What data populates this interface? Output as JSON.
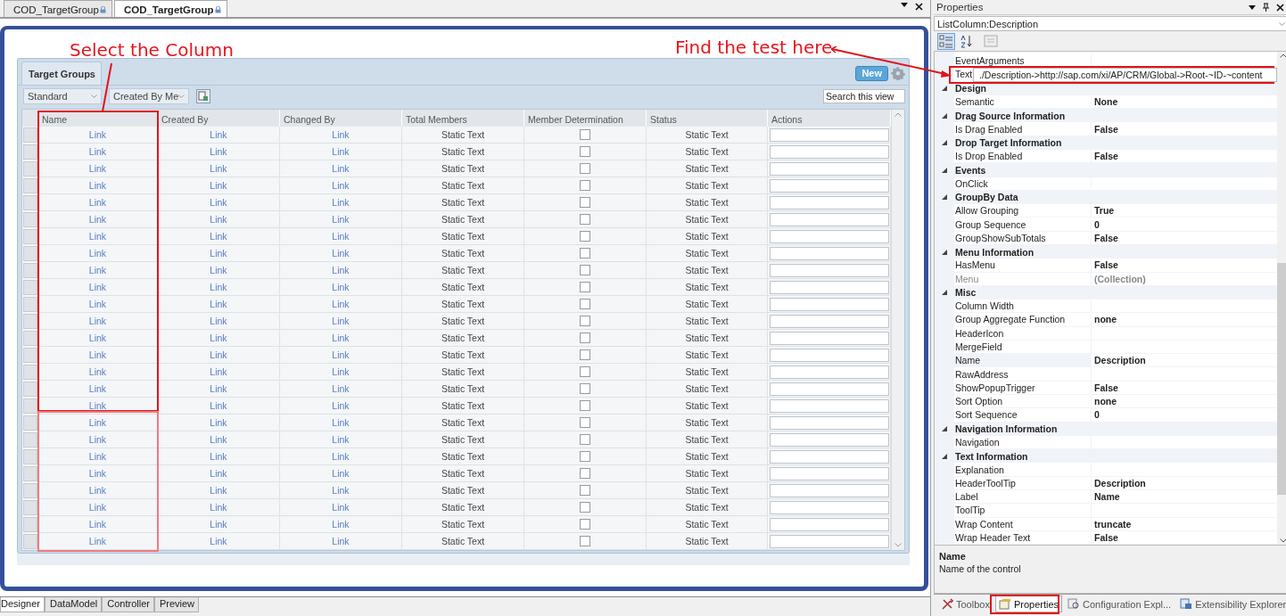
{
  "document_tabs": [
    {
      "label": "COD_TargetGroup",
      "selected": false
    },
    {
      "label": "COD_TargetGroup",
      "selected": true
    }
  ],
  "card": {
    "title": "Target Groups",
    "new_button": "New",
    "filters": [
      {
        "value": "Standard"
      },
      {
        "value": "Created By Me"
      }
    ],
    "search": {
      "placeholder": "Search this view"
    }
  },
  "table": {
    "columns": [
      "Name",
      "Created By",
      "Changed By",
      "Total Members",
      "Member Determination",
      "Status",
      "Actions"
    ],
    "rows": [
      {
        "name": "Link",
        "created_by": "Link",
        "changed_by": "Link",
        "total_members": "Static Text",
        "member_determination": false,
        "status": "Static Text"
      },
      {
        "name": "Link",
        "created_by": "Link",
        "changed_by": "Link",
        "total_members": "Static Text",
        "member_determination": false,
        "status": "Static Text"
      },
      {
        "name": "Link",
        "created_by": "Link",
        "changed_by": "Link",
        "total_members": "Static Text",
        "member_determination": false,
        "status": "Static Text"
      },
      {
        "name": "Link",
        "created_by": "Link",
        "changed_by": "Link",
        "total_members": "Static Text",
        "member_determination": false,
        "status": "Static Text"
      },
      {
        "name": "Link",
        "created_by": "Link",
        "changed_by": "Link",
        "total_members": "Static Text",
        "member_determination": false,
        "status": "Static Text"
      },
      {
        "name": "Link",
        "created_by": "Link",
        "changed_by": "Link",
        "total_members": "Static Text",
        "member_determination": false,
        "status": "Static Text"
      },
      {
        "name": "Link",
        "created_by": "Link",
        "changed_by": "Link",
        "total_members": "Static Text",
        "member_determination": false,
        "status": "Static Text"
      },
      {
        "name": "Link",
        "created_by": "Link",
        "changed_by": "Link",
        "total_members": "Static Text",
        "member_determination": false,
        "status": "Static Text"
      },
      {
        "name": "Link",
        "created_by": "Link",
        "changed_by": "Link",
        "total_members": "Static Text",
        "member_determination": false,
        "status": "Static Text"
      },
      {
        "name": "Link",
        "created_by": "Link",
        "changed_by": "Link",
        "total_members": "Static Text",
        "member_determination": false,
        "status": "Static Text"
      },
      {
        "name": "Link",
        "created_by": "Link",
        "changed_by": "Link",
        "total_members": "Static Text",
        "member_determination": false,
        "status": "Static Text"
      },
      {
        "name": "Link",
        "created_by": "Link",
        "changed_by": "Link",
        "total_members": "Static Text",
        "member_determination": false,
        "status": "Static Text"
      },
      {
        "name": "Link",
        "created_by": "Link",
        "changed_by": "Link",
        "total_members": "Static Text",
        "member_determination": false,
        "status": "Static Text"
      },
      {
        "name": "Link",
        "created_by": "Link",
        "changed_by": "Link",
        "total_members": "Static Text",
        "member_determination": false,
        "status": "Static Text"
      },
      {
        "name": "Link",
        "created_by": "Link",
        "changed_by": "Link",
        "total_members": "Static Text",
        "member_determination": false,
        "status": "Static Text"
      },
      {
        "name": "Link",
        "created_by": "Link",
        "changed_by": "Link",
        "total_members": "Static Text",
        "member_determination": false,
        "status": "Static Text"
      },
      {
        "name": "Link",
        "created_by": "Link",
        "changed_by": "Link",
        "total_members": "Static Text",
        "member_determination": false,
        "status": "Static Text"
      },
      {
        "name": "Link",
        "created_by": "Link",
        "changed_by": "Link",
        "total_members": "Static Text",
        "member_determination": false,
        "status": "Static Text"
      },
      {
        "name": "Link",
        "created_by": "Link",
        "changed_by": "Link",
        "total_members": "Static Text",
        "member_determination": false,
        "status": "Static Text"
      },
      {
        "name": "Link",
        "created_by": "Link",
        "changed_by": "Link",
        "total_members": "Static Text",
        "member_determination": false,
        "status": "Static Text"
      },
      {
        "name": "Link",
        "created_by": "Link",
        "changed_by": "Link",
        "total_members": "Static Text",
        "member_determination": false,
        "status": "Static Text"
      },
      {
        "name": "Link",
        "created_by": "Link",
        "changed_by": "Link",
        "total_members": "Static Text",
        "member_determination": false,
        "status": "Static Text"
      },
      {
        "name": "Link",
        "created_by": "Link",
        "changed_by": "Link",
        "total_members": "Static Text",
        "member_determination": false,
        "status": "Static Text"
      },
      {
        "name": "Link",
        "created_by": "Link",
        "changed_by": "Link",
        "total_members": "Static Text",
        "member_determination": false,
        "status": "Static Text"
      },
      {
        "name": "Link",
        "created_by": "Link",
        "changed_by": "Link",
        "total_members": "Static Text",
        "member_determination": false,
        "status": "Static Text"
      }
    ]
  },
  "designer_tabs": [
    {
      "label": "Designer",
      "selected": true
    },
    {
      "label": "DataModel",
      "selected": false
    },
    {
      "label": "Controller",
      "selected": false
    },
    {
      "label": "Preview",
      "selected": false
    }
  ],
  "properties": {
    "title": "Properties",
    "object": "ListColumn:Description",
    "sort_modes": [
      {
        "kind": "categorized",
        "selected": true
      },
      {
        "kind": "alphabetical",
        "selected": false
      }
    ],
    "rows": [
      {
        "kind": "item",
        "name": "EventArguments",
        "disabled": false,
        "selected": false
      },
      {
        "kind": "editing",
        "name": "Text",
        "value": "./Description->http://sap.com/xi/AP/CRM/Global->Root-~ID-~content",
        "disabled": false,
        "selected": false
      },
      {
        "kind": "group",
        "name": "Design",
        "expanded": true
      },
      {
        "kind": "item",
        "name": "Semantic",
        "value": "None",
        "disabled": false,
        "selected": false
      },
      {
        "kind": "group",
        "name": "Drag Source Information",
        "expanded": true
      },
      {
        "kind": "item",
        "name": "Is Drag Enabled",
        "value": "False",
        "disabled": false,
        "selected": false
      },
      {
        "kind": "group",
        "name": "Drop Target Information",
        "expanded": true
      },
      {
        "kind": "item",
        "name": "Is Drop Enabled",
        "value": "False",
        "disabled": false,
        "selected": false
      },
      {
        "kind": "group",
        "name": "Events",
        "expanded": true
      },
      {
        "kind": "item",
        "name": "OnClick",
        "disabled": false,
        "selected": false
      },
      {
        "kind": "group",
        "name": "GroupBy Data",
        "expanded": true
      },
      {
        "kind": "item",
        "name": "Allow Grouping",
        "value": "True",
        "disabled": false,
        "selected": false
      },
      {
        "kind": "item",
        "name": "Group Sequence",
        "value": "0",
        "disabled": false,
        "selected": false
      },
      {
        "kind": "item",
        "name": "GroupShowSubTotals",
        "value": "False",
        "disabled": false,
        "selected": false
      },
      {
        "kind": "group",
        "name": "Menu Information",
        "expanded": true
      },
      {
        "kind": "item",
        "name": "HasMenu",
        "value": "False",
        "disabled": false,
        "selected": false
      },
      {
        "kind": "item",
        "name": "Menu",
        "value": "(Collection)",
        "disabled": true,
        "selected": false
      },
      {
        "kind": "group",
        "name": "Misc",
        "expanded": true
      },
      {
        "kind": "item",
        "name": "Column Width",
        "disabled": false,
        "selected": false
      },
      {
        "kind": "item",
        "name": "Group Aggregate Function",
        "value": "none",
        "disabled": false,
        "selected": false
      },
      {
        "kind": "item",
        "name": "HeaderIcon",
        "disabled": false,
        "selected": false
      },
      {
        "kind": "item",
        "name": "MergeField",
        "disabled": false,
        "selected": false
      },
      {
        "kind": "item",
        "name": "Name",
        "value": "Description",
        "disabled": false,
        "selected": true
      },
      {
        "kind": "item",
        "name": "RawAddress",
        "disabled": false,
        "selected": false
      },
      {
        "kind": "item",
        "name": "ShowPopupTrigger",
        "value": "False",
        "disabled": false,
        "selected": false
      },
      {
        "kind": "item",
        "name": "Sort Option",
        "value": "none",
        "disabled": false,
        "selected": false
      },
      {
        "kind": "item",
        "name": "Sort Sequence",
        "value": "0",
        "disabled": false,
        "selected": false
      },
      {
        "kind": "group",
        "name": "Navigation Information",
        "expanded": true
      },
      {
        "kind": "item",
        "name": "Navigation",
        "disabled": false,
        "selected": false
      },
      {
        "kind": "group",
        "name": "Text Information",
        "expanded": true
      },
      {
        "kind": "item",
        "name": "Explanation",
        "disabled": false,
        "selected": false
      },
      {
        "kind": "item",
        "name": "HeaderToolTip",
        "value": "Description",
        "disabled": false,
        "selected": false
      },
      {
        "kind": "item",
        "name": "Label",
        "value": "Name",
        "disabled": false,
        "selected": false
      },
      {
        "kind": "item",
        "name": "ToolTip",
        "disabled": false,
        "selected": false
      },
      {
        "kind": "item",
        "name": "Wrap Content",
        "value": "truncate",
        "disabled": false,
        "selected": false
      },
      {
        "kind": "item",
        "name": "Wrap Header Text",
        "value": "False",
        "disabled": false,
        "selected": false
      }
    ],
    "description": {
      "title": "Name",
      "text": "Name of the control"
    }
  },
  "panel_tabs": [
    {
      "label": "Toolbox",
      "kind": "toolbox",
      "selected": false
    },
    {
      "label": "Properties",
      "kind": "properties",
      "selected": true
    },
    {
      "label": "Configuration Expl...",
      "kind": "configuration",
      "selected": false
    },
    {
      "label": "Extensibility Explorer",
      "kind": "extensibility",
      "selected": false
    }
  ],
  "annotations": [
    {
      "text": "Select the Column"
    },
    {
      "text": "Find the test here"
    }
  ]
}
